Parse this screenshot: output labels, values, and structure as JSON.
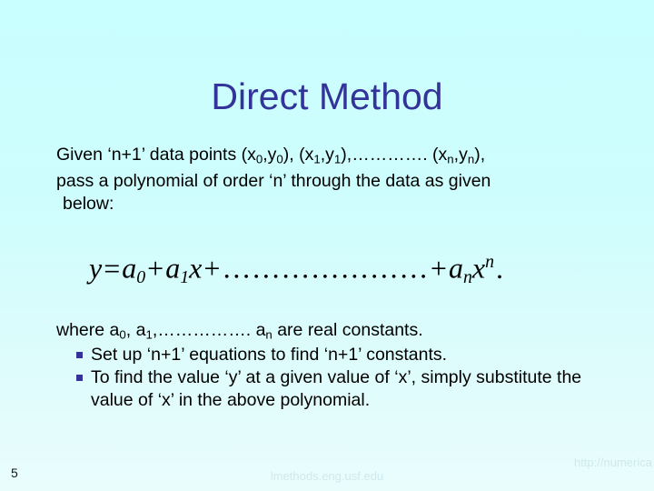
{
  "slide": {
    "title": "Direct Method",
    "background_top_color": "#c9ffff",
    "background_bottom_color": "#eafdfd",
    "title_color": "#333399",
    "bullet_marker_color": "#333399"
  },
  "intro": {
    "line1_a": "Given ‘n+1’ data points (x",
    "line1_sub1": "0",
    "line1_b": ",y",
    "line1_sub2": "0",
    "line1_c": "), (x",
    "line1_sub3": "1",
    "line1_d": ",y",
    "line1_sub4": "1",
    "line1_e": "),…………. (x",
    "line1_sub5": "n",
    "line1_f": ",y",
    "line1_sub6": "n",
    "line1_g": "),",
    "line2": "pass a polynomial of order ‘n’ through the data as given",
    "line3": "below:"
  },
  "equation": {
    "lhs": "y",
    "equals": "=",
    "a0": "a",
    "a0_sub": "0",
    "plus1": "+",
    "a1": "a",
    "a1_sub": "1",
    "x1": "x",
    "plus2": "+",
    "dots": "…………………",
    "plus3": "+",
    "an": "a",
    "an_sub": "n",
    "xn": "x",
    "xn_sup": "n",
    "period": "."
  },
  "where": {
    "text_a": "where a",
    "sub1": "0",
    "text_b": ", a",
    "sub2": "1",
    "text_c": ",……………. a",
    "sub3": "n",
    "text_d": " are real constants."
  },
  "bullets": [
    {
      "text": "Set up ‘n+1’ equations to find ‘n+1’ constants."
    },
    {
      "text": "To find the value ‘y’ at a given value of ‘x’, simply substitute the value of ‘x’ in the above polynomial."
    }
  ],
  "footer": {
    "page_number": "5",
    "url_line_1": "http://numerica",
    "url_line_2": "lmethods.eng.usf.edu"
  }
}
